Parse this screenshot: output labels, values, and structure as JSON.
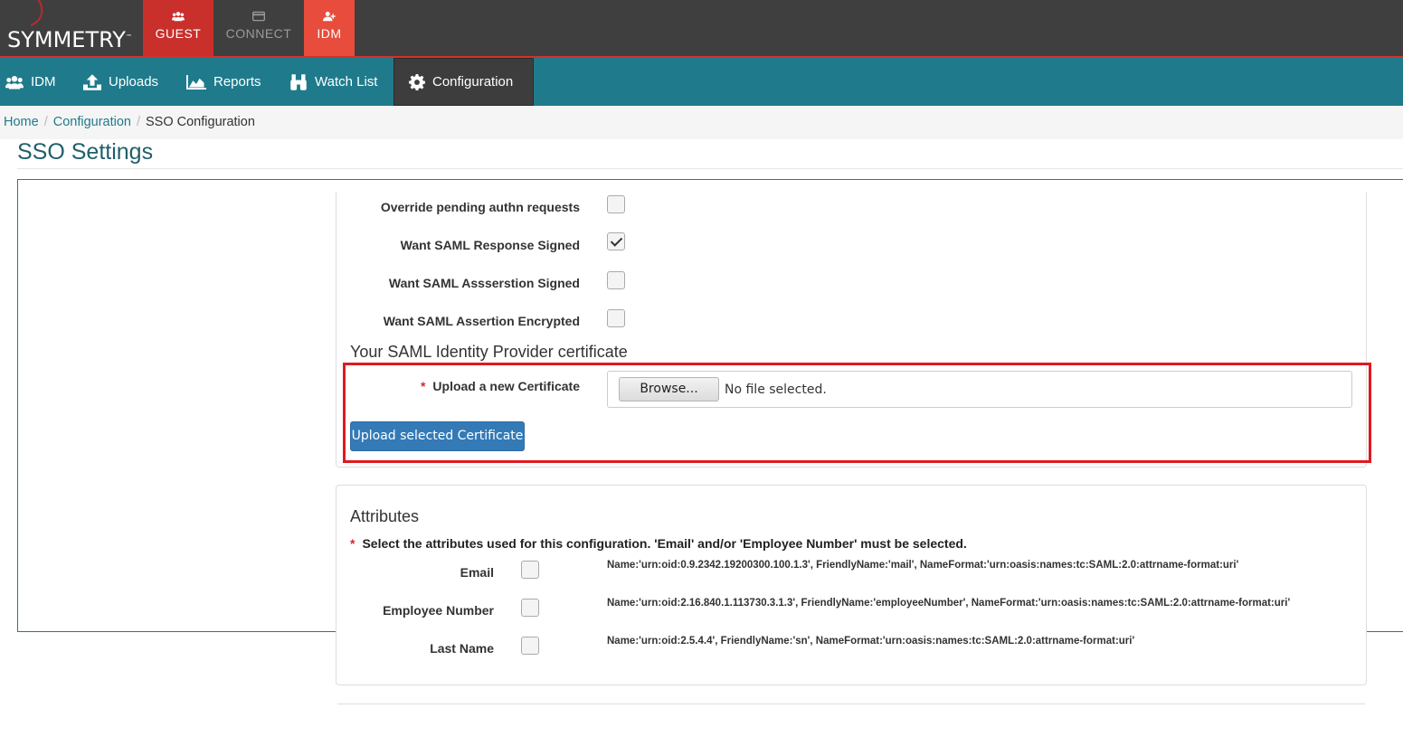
{
  "brand": {
    "name": "SYMMETRY",
    "tm": "™"
  },
  "top_nav": [
    {
      "label": "GUEST",
      "icon": "users-icon"
    },
    {
      "label": "CONNECT",
      "icon": "card-icon"
    },
    {
      "label": "IDM",
      "icon": "user-plus-icon"
    }
  ],
  "sub_nav": [
    {
      "label": "IDM",
      "icon": "users-icon"
    },
    {
      "label": "Uploads",
      "icon": "upload-icon"
    },
    {
      "label": "Reports",
      "icon": "area-chart-icon"
    },
    {
      "label": "Watch List",
      "icon": "binoculars-icon"
    },
    {
      "label": "Configuration",
      "icon": "gear-icon",
      "active": true
    }
  ],
  "breadcrumb": {
    "home": "Home",
    "config": "Configuration",
    "current": "SSO Configuration"
  },
  "page_title": "SSO Settings",
  "saml_options": [
    {
      "label": "Override pending authn requests",
      "checked": false
    },
    {
      "label": "Want SAML Response Signed",
      "checked": true
    },
    {
      "label": "Want SAML Assserstion Signed",
      "checked": false
    },
    {
      "label": "Want SAML Assertion Encrypted",
      "checked": false
    }
  ],
  "certificate": {
    "heading": "Your SAML Identity Provider certificate",
    "required_mark": "*",
    "upload_label": "Upload a new Certificate",
    "browse_label": "Browse...",
    "no_file_text": "No file selected.",
    "upload_button": "Upload selected Certificate"
  },
  "attributes": {
    "heading": "Attributes",
    "required_mark": "*",
    "instruction": "Select the attributes used for this configuration. 'Email' and/or 'Employee Number' must be selected.",
    "items": [
      {
        "label": "Email",
        "checked": false,
        "desc": "Name:'urn:oid:0.9.2342.19200300.100.1.3', FriendlyName:'mail', NameFormat:'urn:oasis:names:tc:SAML:2.0:attrname-format:uri'"
      },
      {
        "label": "Employee Number",
        "checked": false,
        "desc": "Name:'urn:oid:2.16.840.1.113730.3.1.3', FriendlyName:'employeeNumber', NameFormat:'urn:oasis:names:tc:SAML:2.0:attrname-format:uri'"
      },
      {
        "label": "Last Name",
        "checked": false,
        "desc": "Name:'urn:oid:2.5.4.4', FriendlyName:'sn', NameFormat:'urn:oasis:names:tc:SAML:2.0:attrname-format:uri'"
      }
    ]
  },
  "colors": {
    "teal": "#1f7b8c",
    "red": "#c9302c",
    "highlight": "#e0191f",
    "primary": "#337ab7"
  }
}
